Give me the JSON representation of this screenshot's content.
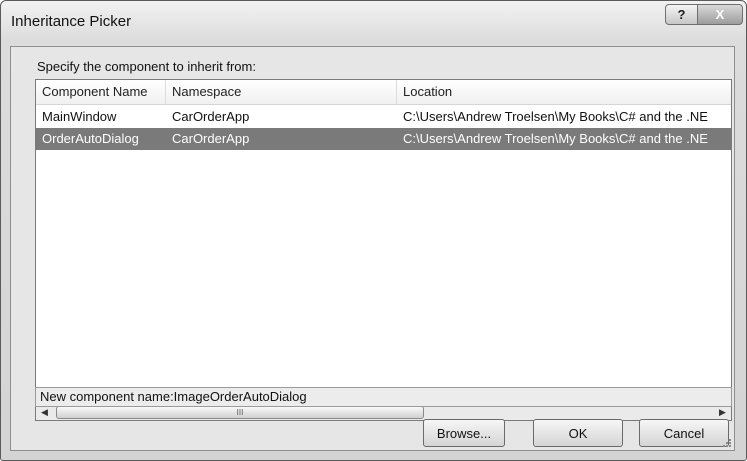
{
  "window": {
    "title": "Inheritance Picker",
    "help_glyph": "?",
    "close_glyph": "X"
  },
  "prompt": "Specify the component to inherit from:",
  "list": {
    "columns": [
      "Component Name",
      "Namespace",
      "Location"
    ],
    "rows": [
      {
        "name": "MainWindow",
        "namespace": "CarOrderApp",
        "location": "C:\\Users\\Andrew Troelsen\\My Books\\C# and the .NE",
        "selected": false
      },
      {
        "name": "OrderAutoDialog",
        "namespace": "CarOrderApp",
        "location": "C:\\Users\\Andrew Troelsen\\My Books\\C# and the .NE",
        "selected": true
      }
    ],
    "scroll_left": "◀",
    "scroll_right": "▶",
    "thumb_grip": "III"
  },
  "new_component": "New component name:ImageOrderAutoDialog",
  "buttons": {
    "browse": "Browse...",
    "ok": "OK",
    "cancel": "Cancel"
  }
}
